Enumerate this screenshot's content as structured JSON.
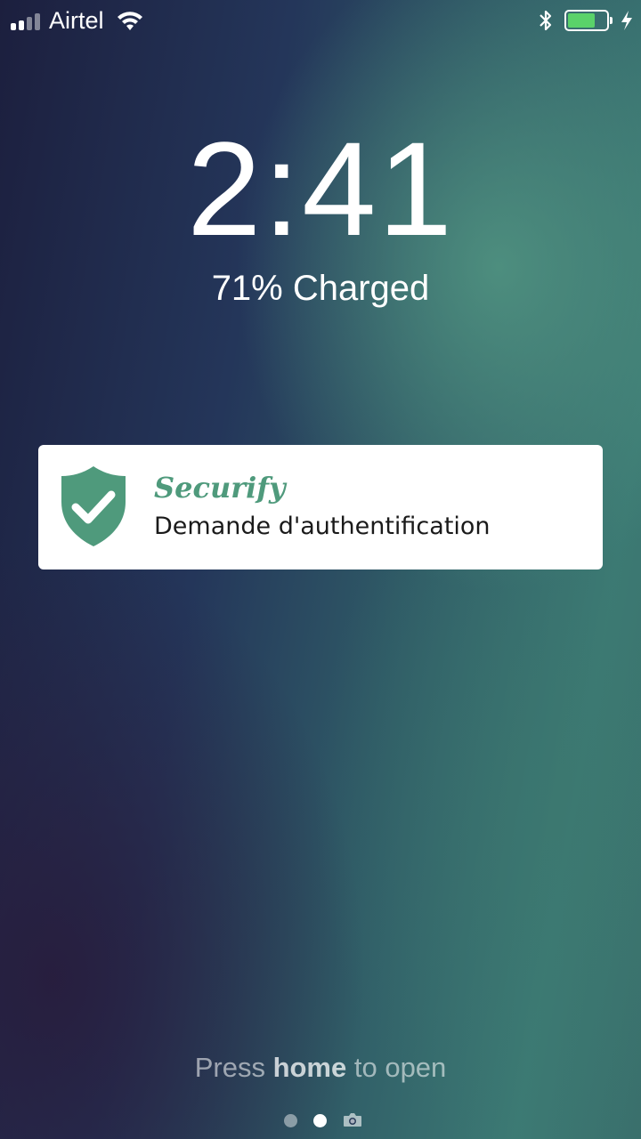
{
  "status_bar": {
    "carrier": "Airtel",
    "signal_bars_filled": 2,
    "signal_bars_total": 4,
    "icons": [
      "signal-icon",
      "wifi-icon",
      "bluetooth-icon",
      "battery-icon",
      "charging-bolt-icon"
    ],
    "battery_level": 0.71,
    "battery_color": "#5ad26a"
  },
  "lock_screen": {
    "time": "2:41",
    "charge_status": "71% Charged"
  },
  "notification": {
    "app_name": "Securify",
    "message": "Demande d'authentification",
    "icon": "shield-check-icon",
    "accent_color": "#4f9a7c"
  },
  "footer": {
    "prompt_prefix": "Press ",
    "prompt_bold": "home",
    "prompt_suffix": " to open",
    "page_count": 2,
    "active_page": 2,
    "camera_icon": "camera-icon"
  }
}
